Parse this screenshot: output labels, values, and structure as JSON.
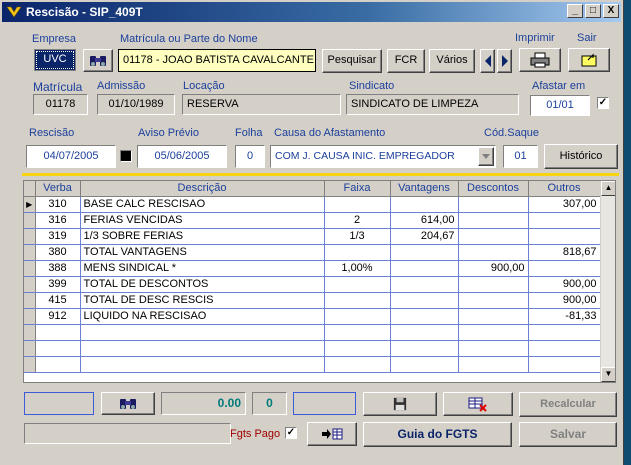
{
  "window": {
    "title": "Rescisão - SIP_409T",
    "controls": [
      "_",
      "□",
      "X"
    ]
  },
  "top": {
    "empresa_label": "Empresa",
    "empresa_value": "UVC",
    "matricula_nome_label": "Matrícula ou Parte do Nome",
    "matricula_nome_value": "01178 - JOAO BATISTA CAVALCANTE",
    "pesquisar": "Pesquisar",
    "fcr": "FCR",
    "varios": "Vários",
    "imprimir_label": "Imprimir",
    "sair_label": "Sair"
  },
  "info": {
    "matricula_label": "Matrícula",
    "matricula_value": "01178",
    "admissao_label": "Admissão",
    "admissao_value": "01/10/1989",
    "locacao_label": "Locação",
    "locacao_value": "RESERVA",
    "sindicato_label": "Sindicato",
    "sindicato_value": "SINDICATO DE LIMPEZA",
    "afastar_label": "Afastar em",
    "afastar_value": "01/01",
    "afastar_checked": "✓"
  },
  "rescisao": {
    "rescisao_label": "Rescisão",
    "rescisao_value": "04/07/2005",
    "aviso_label": "Aviso Prévio",
    "aviso_value": "05/06/2005",
    "folha_label": "Folha",
    "folha_value": "0",
    "causa_label": "Causa do Afastamento",
    "causa_value": "COM J. CAUSA INIC. EMPREGADOR",
    "codsaque_label": "Cód.Saque",
    "codsaque_value": "01",
    "historico": "Histórico"
  },
  "grid": {
    "columns": [
      "Verba",
      "Descrição",
      "Faixa",
      "Vantagens",
      "Descontos",
      "Outros"
    ],
    "rows": [
      [
        "310",
        "BASE CALC RESCISAO",
        "",
        "",
        "",
        "307,00"
      ],
      [
        "316",
        "FERIAS VENCIDAS",
        "2",
        "614,00",
        "",
        ""
      ],
      [
        "319",
        "1/3 SOBRE FERIAS",
        "1/3",
        "204,67",
        "",
        ""
      ],
      [
        "380",
        "TOTAL VANTAGENS",
        "",
        "",
        "",
        "818,67"
      ],
      [
        "388",
        "MENS SINDICAL *",
        "1,00%",
        "",
        "900,00",
        ""
      ],
      [
        "399",
        "TOTAL DE DESCONTOS",
        "",
        "",
        "",
        "900,00"
      ],
      [
        "415",
        "TOTAL DE DESC RESCIS",
        "",
        "",
        "",
        "900,00"
      ],
      [
        "912",
        "LIQUIDO NA RESCISAO",
        "",
        "",
        "",
        "-81,33"
      ]
    ]
  },
  "bottom": {
    "total_value": "0.00",
    "count_value": "0",
    "recalcular": "Recalcular",
    "fgts_pago_label": "Fgts Pago",
    "fgts_checked": "✓",
    "guia_fgts": "Guia do FGTS",
    "salvar": "Salvar"
  },
  "colors": {
    "title_start": "#0a246a",
    "label_blue": "#1b3f9c",
    "yellow_field": "#ffffc0",
    "accent_yellow": "#f6d411"
  }
}
